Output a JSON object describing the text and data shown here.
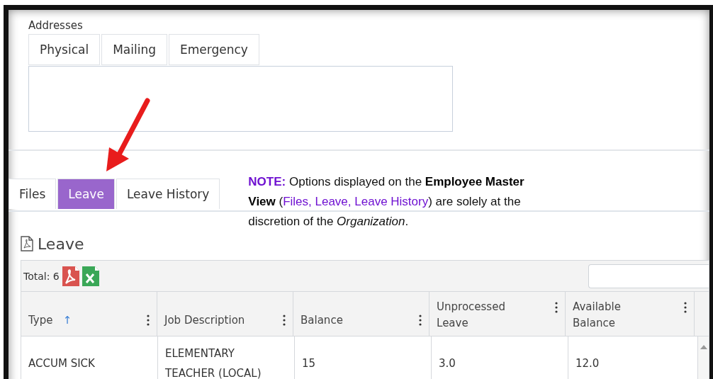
{
  "addresses": {
    "label": "Addresses",
    "tabs": [
      {
        "label": "Physical",
        "selected": false
      },
      {
        "label": "Mailing",
        "selected": false
      },
      {
        "label": "Emergency",
        "selected": false
      }
    ]
  },
  "tabs": [
    {
      "label": "Files",
      "selected": false
    },
    {
      "label": "Leave",
      "selected": true
    },
    {
      "label": "Leave History",
      "selected": false
    }
  ],
  "note": [
    {
      "kind": "accent-bold",
      "text": "NOTE:"
    },
    {
      "kind": "plain",
      "text": " Options displayed on the "
    },
    {
      "kind": "bold",
      "text": "Employee Master View"
    },
    {
      "kind": "plain",
      "text": " ("
    },
    {
      "kind": "accent",
      "text": "Files, Leave, Leave History"
    },
    {
      "kind": "plain",
      "text": ") are solely at the discretion of the "
    },
    {
      "kind": "italic",
      "text": "Organization"
    },
    {
      "kind": "plain",
      "text": "."
    }
  ],
  "section_title": "Leave",
  "grid": {
    "total": "Total: 6",
    "columns": [
      {
        "label": "Type",
        "sort_indicator": "↑"
      },
      {
        "label": "Job Description"
      },
      {
        "label": "Balance"
      },
      {
        "label": "Unprocessed Leave"
      },
      {
        "label": "Available Balance"
      }
    ],
    "rows": [
      [
        "ACCUM SICK",
        "ELEMENTARY TEACHER (LOCAL)",
        "15",
        "3.0",
        "12.0"
      ]
    ]
  }
}
